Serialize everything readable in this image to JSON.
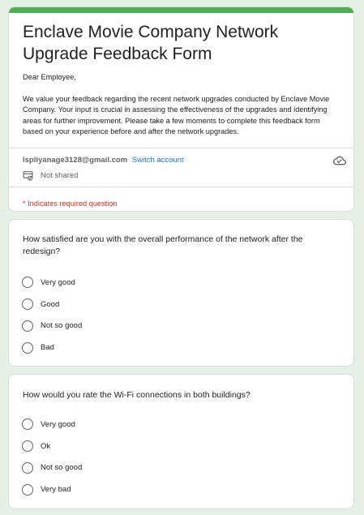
{
  "form": {
    "title": "Enclave Movie Company Network Upgrade Feedback Form",
    "greeting": "Dear Employee,",
    "description": "We value your feedback regarding the recent network upgrades conducted by Enclave Movie Company. Your input is crucial in assessing the effectiveness of the upgrades and identifying areas for further improvement. Please take a few moments to complete this feedback form based on your experience before and after the network upgrades.",
    "accent_color": "#4caf50"
  },
  "account": {
    "email": "lspliyanage3128@gmail.com",
    "switch_label": "Switch account",
    "shared_status": "Not shared"
  },
  "required_note": "* Indicates required question",
  "questions": [
    {
      "text": "How satisfied are you with the overall performance of the network after the redesign?",
      "options": [
        "Very good",
        "Good",
        "Not so good",
        "Bad"
      ]
    },
    {
      "text": "How would you rate the Wi-Fi connections in both buildings?",
      "options": [
        "Very good",
        "Ok",
        "Not so good",
        "Very bad"
      ]
    }
  ],
  "icons": {
    "cloud": "cloud-done-icon",
    "shared": "not-shared-icon",
    "radio": "radio-unchecked-icon"
  }
}
